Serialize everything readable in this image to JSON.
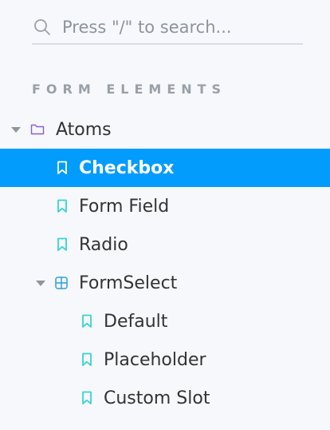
{
  "search": {
    "placeholder": "Press \"/\" to search..."
  },
  "section": {
    "title": "FORM ELEMENTS"
  },
  "tree": {
    "atoms": {
      "label": "Atoms",
      "expanded": true
    },
    "checkbox": {
      "label": "Checkbox",
      "selected": true
    },
    "form_field": {
      "label": "Form Field"
    },
    "radio": {
      "label": "Radio"
    },
    "form_select": {
      "label": "FormSelect",
      "expanded": true
    },
    "default": {
      "label": "Default"
    },
    "placeholder": {
      "label": "Placeholder"
    },
    "custom_slot": {
      "label": "Custom Slot"
    }
  },
  "colors": {
    "selected_bg": "#029cfd",
    "folder_icon": "#8c5cd6",
    "component_icon": "#2f9de0",
    "story_icon": "#37d5d3",
    "muted": "#9aa0a7"
  },
  "icons": {
    "search": "search-icon",
    "folder": "folder-icon",
    "component": "component-icon",
    "story": "bookmark-icon",
    "expand": "chevron-down-icon"
  }
}
